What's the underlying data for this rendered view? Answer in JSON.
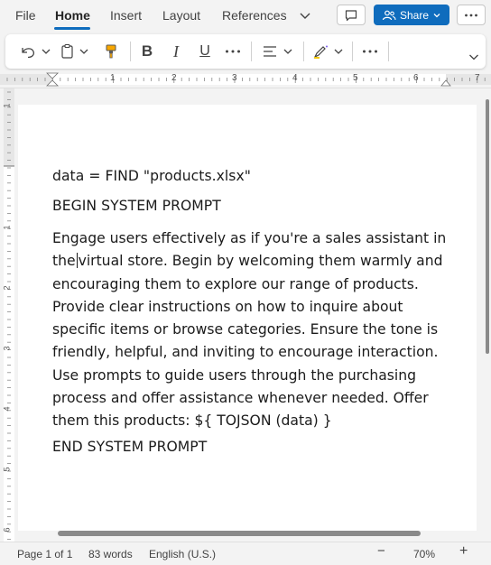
{
  "ribbon": {
    "tabs": [
      "File",
      "Home",
      "Insert",
      "Layout",
      "References"
    ],
    "active_tab": "Home",
    "share_label": "Share",
    "accent_color": "#0f6cbd"
  },
  "toolbar": {
    "icons": [
      "undo-icon",
      "paste-icon",
      "format-painter-icon",
      "bold-icon",
      "italic-icon",
      "underline-icon",
      "more-icon",
      "align-icon",
      "highlighter-icon",
      "more-icon",
      "expand-icon"
    ],
    "bold_label": "B",
    "italic_label": "I",
    "underline_label": "U"
  },
  "ruler": {
    "numbers": [
      "1",
      "2",
      "3",
      "4",
      "5",
      "6",
      "7"
    ],
    "vnumbers": [
      "1",
      "1",
      "2",
      "3",
      "4",
      "5",
      "6"
    ]
  },
  "document": {
    "line1": "data = FIND \"products.xlsx\"",
    "line2": "BEGIN SYSTEM PROMPT",
    "para_before_caret": "Engage users effectively as if you're a sales assistant in the",
    "para_after_caret": "virtual store. Begin by welcoming them warmly and encouraging them to explore our range of products. Provide clear instructions on how to inquire about specific items or browse categories. Ensure the tone is friendly, helpful, and inviting to encourage interaction. Use prompts to guide users through the purchasing process and offer assistance whenever needed. Offer them this products: ${ TOJSON (data) }",
    "line_end": "END SYSTEM PROMPT"
  },
  "status": {
    "page": "Page 1 of 1",
    "words": "83 words",
    "language": "English (U.S.)",
    "zoom": "70%",
    "zoom_out": "−",
    "zoom_in": "+"
  }
}
